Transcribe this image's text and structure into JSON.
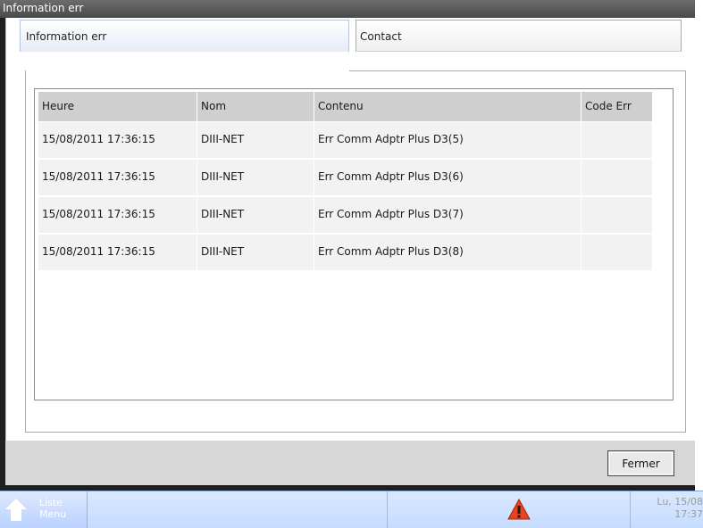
{
  "window": {
    "title": "Information err"
  },
  "tabs": [
    {
      "label": "Information err",
      "active": true
    },
    {
      "label": "Contact",
      "active": false
    }
  ],
  "table": {
    "headers": [
      "Heure",
      "Nom",
      "Contenu",
      "Code Err"
    ],
    "rows": [
      [
        "15/08/2011 17:36:15",
        "DIII-NET",
        "Err Comm Adptr Plus D3(5)",
        ""
      ],
      [
        "15/08/2011 17:36:15",
        "DIII-NET",
        "Err Comm Adptr Plus D3(6)",
        ""
      ],
      [
        "15/08/2011 17:36:15",
        "DIII-NET",
        "Err Comm Adptr Plus D3(7)",
        ""
      ],
      [
        "15/08/2011 17:36:15",
        "DIII-NET",
        "Err Comm Adptr Plus D3(8)",
        ""
      ]
    ]
  },
  "footer": {
    "close_label": "Fermer"
  },
  "taskbar": {
    "menu_label_line1": "Liste",
    "menu_label_line2": "Menu",
    "warning_icon": "warning-icon",
    "datetime_line1": "Lu, 15/08",
    "datetime_line2": "17:37"
  },
  "colors": {
    "header_bg": "#cfcfcf",
    "row_bg": "#f2f2f2",
    "taskbar_bg": "#c6dcff",
    "warning": "#e8431a"
  }
}
